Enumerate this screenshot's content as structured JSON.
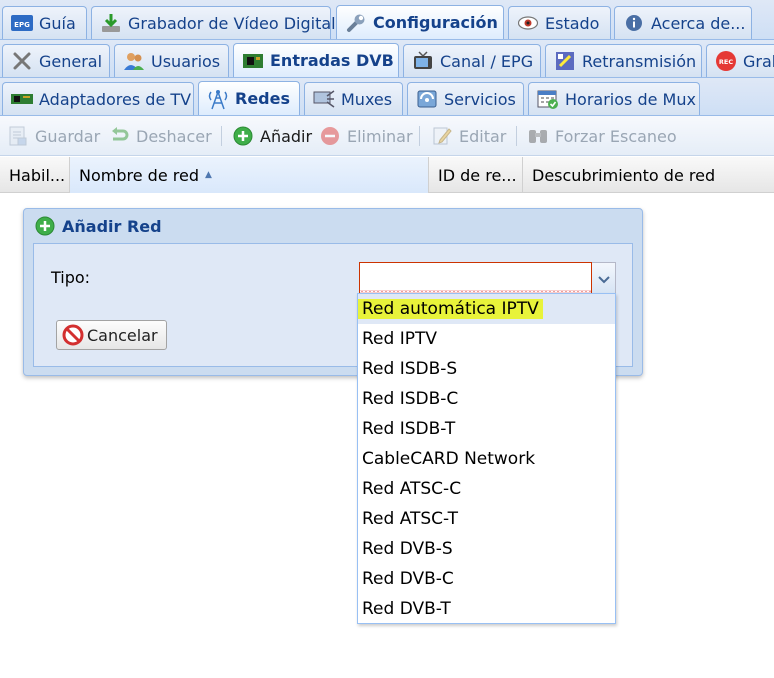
{
  "top_tabs": [
    {
      "label": "Guía",
      "icon": "epg-icon"
    },
    {
      "label": "Grabador de Vídeo Digital",
      "icon": "download-icon"
    },
    {
      "label": "Configuración",
      "icon": "wrench-icon",
      "active": true
    },
    {
      "label": "Estado",
      "icon": "eye-icon"
    },
    {
      "label": "Acerca de...",
      "icon": "info-icon"
    }
  ],
  "config_tabs": [
    {
      "label": "General",
      "icon": "tools-icon"
    },
    {
      "label": "Usuarios",
      "icon": "users-icon"
    },
    {
      "label": "Entradas DVB",
      "icon": "card-icon",
      "active": true
    },
    {
      "label": "Canal / EPG",
      "icon": "tv-icon"
    },
    {
      "label": "Retransmisión",
      "icon": "stream-icon"
    },
    {
      "label": "Grab",
      "icon": "rec-icon"
    }
  ],
  "dvb_tabs": [
    {
      "label": "Adaptadores de TV",
      "icon": "adapter-icon"
    },
    {
      "label": "Redes",
      "icon": "antenna-icon",
      "active": true
    },
    {
      "label": "Muxes",
      "icon": "mux-icon"
    },
    {
      "label": "Servicios",
      "icon": "services-icon"
    },
    {
      "label": "Horarios de Mux",
      "icon": "calendar-icon"
    }
  ],
  "toolbar": {
    "save": "Guardar",
    "undo": "Deshacer",
    "add": "Añadir",
    "delete": "Eliminar",
    "edit": "Editar",
    "force_scan": "Forzar Escaneo"
  },
  "grid": {
    "columns": [
      "Habil...",
      "Nombre de red",
      "ID de re...",
      "Descubrimiento de red"
    ],
    "sorted_column": "Nombre de red",
    "sort_direction": "asc"
  },
  "dialog": {
    "title": "Añadir Red",
    "type_label": "Tipo:",
    "type_value": "",
    "cancel_label": "Cancelar"
  },
  "dropdown": {
    "options": [
      "Red automática IPTV",
      "Red IPTV",
      "Red ISDB-S",
      "Red ISDB-C",
      "Red ISDB-T",
      "CableCARD Network",
      "Red ATSC-C",
      "Red ATSC-T",
      "Red DVB-S",
      "Red DVB-C",
      "Red DVB-T"
    ],
    "highlighted_index": 0,
    "highlight_color": "#e8f33a"
  },
  "colors": {
    "accent": "#15428b",
    "border": "#99bbe8",
    "add_green": "#3fae49",
    "delete_red": "#e05050",
    "error_red": "#cc3300"
  }
}
